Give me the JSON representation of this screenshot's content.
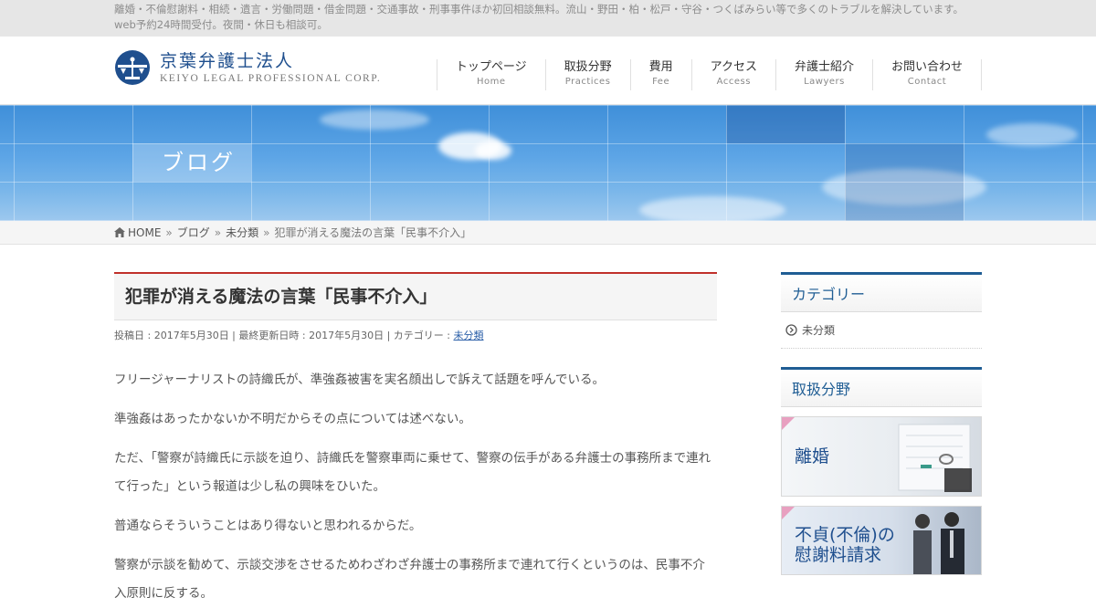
{
  "topbar": {
    "text": "離婚・不倫慰謝料・相続・遺言・労働問題・借金問題・交通事故・刑事事件ほか初回相談無料。流山・野田・柏・松戸・守谷・つくばみらい等で多くのトラブルを解決しています。web予約24時間受付。夜間・休日も相談可。"
  },
  "logo": {
    "name_jp": "京葉弁護士法人",
    "name_en": "KEIYO LEGAL PROFESSIONAL CORP."
  },
  "nav": [
    {
      "jp": "トップページ",
      "en": "Home"
    },
    {
      "jp": "取扱分野",
      "en": "Practices"
    },
    {
      "jp": "費用",
      "en": "Fee"
    },
    {
      "jp": "アクセス",
      "en": "Access"
    },
    {
      "jp": "弁護士紹介",
      "en": "Lawyers"
    },
    {
      "jp": "お問い合わせ",
      "en": "Contact"
    }
  ],
  "hero": {
    "title": "ブログ"
  },
  "breadcrumb": {
    "home": "HOME",
    "sep": "»",
    "blog": "ブログ",
    "category": "未分類",
    "current": "犯罪が消える魔法の言葉「民事不介入」"
  },
  "post": {
    "title": "犯罪が消える魔法の言葉「民事不介入」",
    "meta_prefix": "投稿日 : 2017年5月30日 | 最終更新日時 : 2017年5月30日 | カテゴリー : ",
    "meta_category": "未分類",
    "paragraphs": [
      "フリージャーナリストの詩織氏が、準強姦被害を実名顔出しで訴えて話題を呼んでいる。",
      "準強姦はあったかないか不明だからその点については述べない。",
      "ただ、「警察が詩織氏に示談を迫り、詩織氏を警察車両に乗せて、警察の伝手がある弁護士の事務所まで連れて行った」という報道は少し私の興味をひいた。",
      "普通ならそういうことはあり得ないと思われるからだ。",
      "警察が示談を勧めて、示談交渉をさせるためわざわざ弁護士の事務所まで連れて行くというのは、民事不介入原則に反する。"
    ]
  },
  "sidebar": {
    "category_heading": "カテゴリー",
    "category_items": [
      "未分類"
    ],
    "practice_heading": "取扱分野",
    "banners": [
      "離婚",
      "不貞(不倫)の\n慰謝料請求"
    ]
  },
  "colors": {
    "accent_red": "#c0302a",
    "sidebar_blue": "#1f5d94",
    "link_blue": "#2b5fa8"
  }
}
